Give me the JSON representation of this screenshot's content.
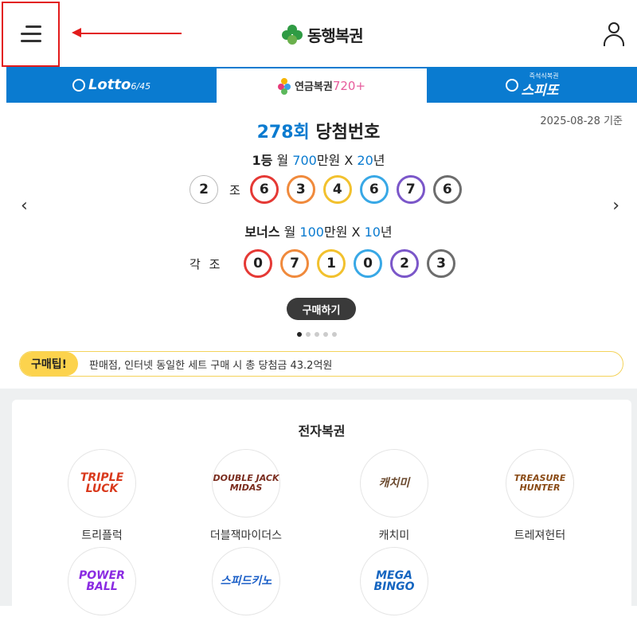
{
  "header": {
    "app_name": "동행복권",
    "menu_icon": "hamburger-icon",
    "user_icon": "user-icon",
    "annotation_color": "#e21b1b"
  },
  "tabs": [
    {
      "label": "Lotto",
      "sub": "6/45"
    },
    {
      "label": "연금복권",
      "sub": "720+"
    },
    {
      "label": "스피또",
      "sub": "즉석식복권"
    }
  ],
  "draw": {
    "date": "2025-08-28 기준",
    "round": "278회",
    "title_suffix": "당첨번호",
    "first": {
      "rank": "1등",
      "pre": "월",
      "amount": "700",
      "unit": "만원 X",
      "years": "20",
      "years_unit": "년"
    },
    "group": "2",
    "group_label": "조",
    "numbers": [
      "6",
      "3",
      "4",
      "6",
      "7",
      "6"
    ],
    "bonus": {
      "rank": "보너스",
      "pre": "월",
      "amount": "100",
      "unit": "만원 X",
      "years": "10",
      "years_unit": "년"
    },
    "bonus_group_label": "각 조",
    "bonus_numbers": [
      "0",
      "7",
      "1",
      "0",
      "2",
      "3"
    ],
    "buy_label": "구매하기",
    "prev": "‹",
    "next": "›"
  },
  "tip": {
    "badge": "구매팁!",
    "text": "판매점, 인터넷 동일한 세트 구매 시 총 당첨금 43.2억원"
  },
  "egame": {
    "title": "전자복권",
    "games": [
      {
        "name": "트리플럭",
        "logo": "TRIPLE LUCK"
      },
      {
        "name": "더블잭마이더스",
        "logo": "DOUBLE JACK MIDAS"
      },
      {
        "name": "캐치미",
        "logo": "캐치미"
      },
      {
        "name": "트레져헌터",
        "logo": "TREASURE HUNTER"
      },
      {
        "name": "",
        "logo": "POWER BALL"
      },
      {
        "name": "",
        "logo": "스피드키노"
      },
      {
        "name": "",
        "logo": "MEGA BINGO"
      }
    ]
  },
  "colors": {
    "brand_blue": "#0a7bd0",
    "ball_colors": [
      "#e53935",
      "#f08a3c",
      "#f2c12e",
      "#38a8e6",
      "#7b57c9",
      "#6d6d6d"
    ]
  }
}
